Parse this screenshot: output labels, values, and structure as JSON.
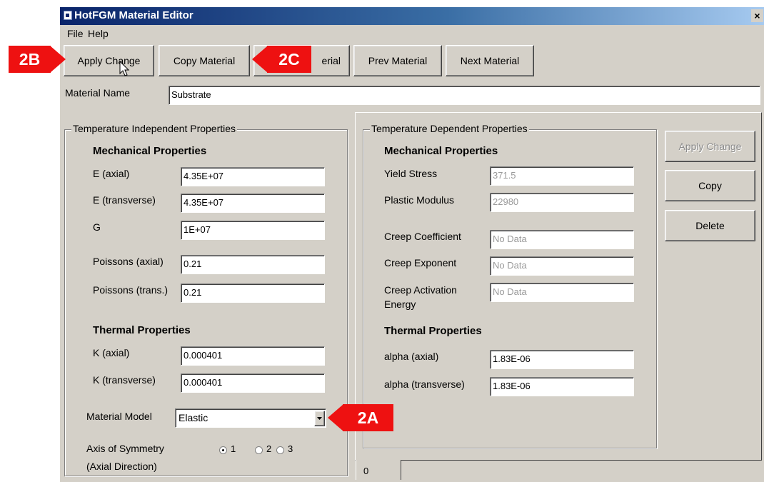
{
  "window": {
    "title": "HotFGM Material Editor",
    "close_glyph": "×"
  },
  "menu": {
    "items": [
      "File",
      "Help"
    ]
  },
  "toolbar": {
    "apply_change": "Apply Change",
    "copy_material": "Copy Material",
    "hidden_button_fragment": "erial",
    "prev_material": "Prev Material",
    "next_material": "Next Material"
  },
  "material_name": {
    "label": "Material Name",
    "value": "Substrate"
  },
  "temp_independent": {
    "title": "Temperature Independent Properties",
    "mechanical_heading": "Mechanical Properties",
    "fields": [
      {
        "label": "E (axial)",
        "value": "4.35E+07"
      },
      {
        "label": "E (transverse)",
        "value": "4.35E+07"
      },
      {
        "label": "G",
        "value": "1E+07"
      },
      {
        "label": "Poissons (axial)",
        "value": "0.21"
      },
      {
        "label": "Poissons (trans.)",
        "value": "0.21"
      }
    ],
    "thermal_heading": "Thermal Properties",
    "thermal_fields": [
      {
        "label": "K (axial)",
        "value": "0.000401"
      },
      {
        "label": "K (transverse)",
        "value": "0.000401"
      }
    ],
    "material_model": {
      "label": "Material Model",
      "value": "Elastic"
    },
    "axis_symmetry": {
      "label_line1": "Axis of Symmetry",
      "label_line2": "(Axial Direction)",
      "options": [
        "1",
        "2",
        "3"
      ],
      "selected": "1"
    }
  },
  "temp_dependent": {
    "title": "Temperature Dependent Properties",
    "mechanical_heading": "Mechanical Properties",
    "fields": [
      {
        "label": "Yield Stress",
        "value": "371.5"
      },
      {
        "label": "Plastic Modulus",
        "value": "22980"
      },
      {
        "label": "Creep Coefficient",
        "value": "No Data"
      },
      {
        "label": "Creep Exponent",
        "value": "No Data"
      },
      {
        "label": "Creep Activation",
        "label2": "Energy",
        "value": "No Data"
      }
    ],
    "thermal_heading": "Thermal Properties",
    "thermal_fields": [
      {
        "label": "alpha (axial)",
        "value": "1.83E-06"
      },
      {
        "label": "alpha (transverse)",
        "value": "1.83E-06"
      }
    ],
    "tab_label": "0"
  },
  "side_buttons": {
    "apply_change": "Apply Change",
    "copy": "Copy",
    "delete": "Delete"
  },
  "annotations": {
    "a": "2A",
    "b": "2B",
    "c": "2C",
    "color": "#ee1111"
  },
  "icons": {
    "dropdown": "chevron-down-icon",
    "cursor": "mouse-pointer-icon",
    "app": "app-icon"
  }
}
